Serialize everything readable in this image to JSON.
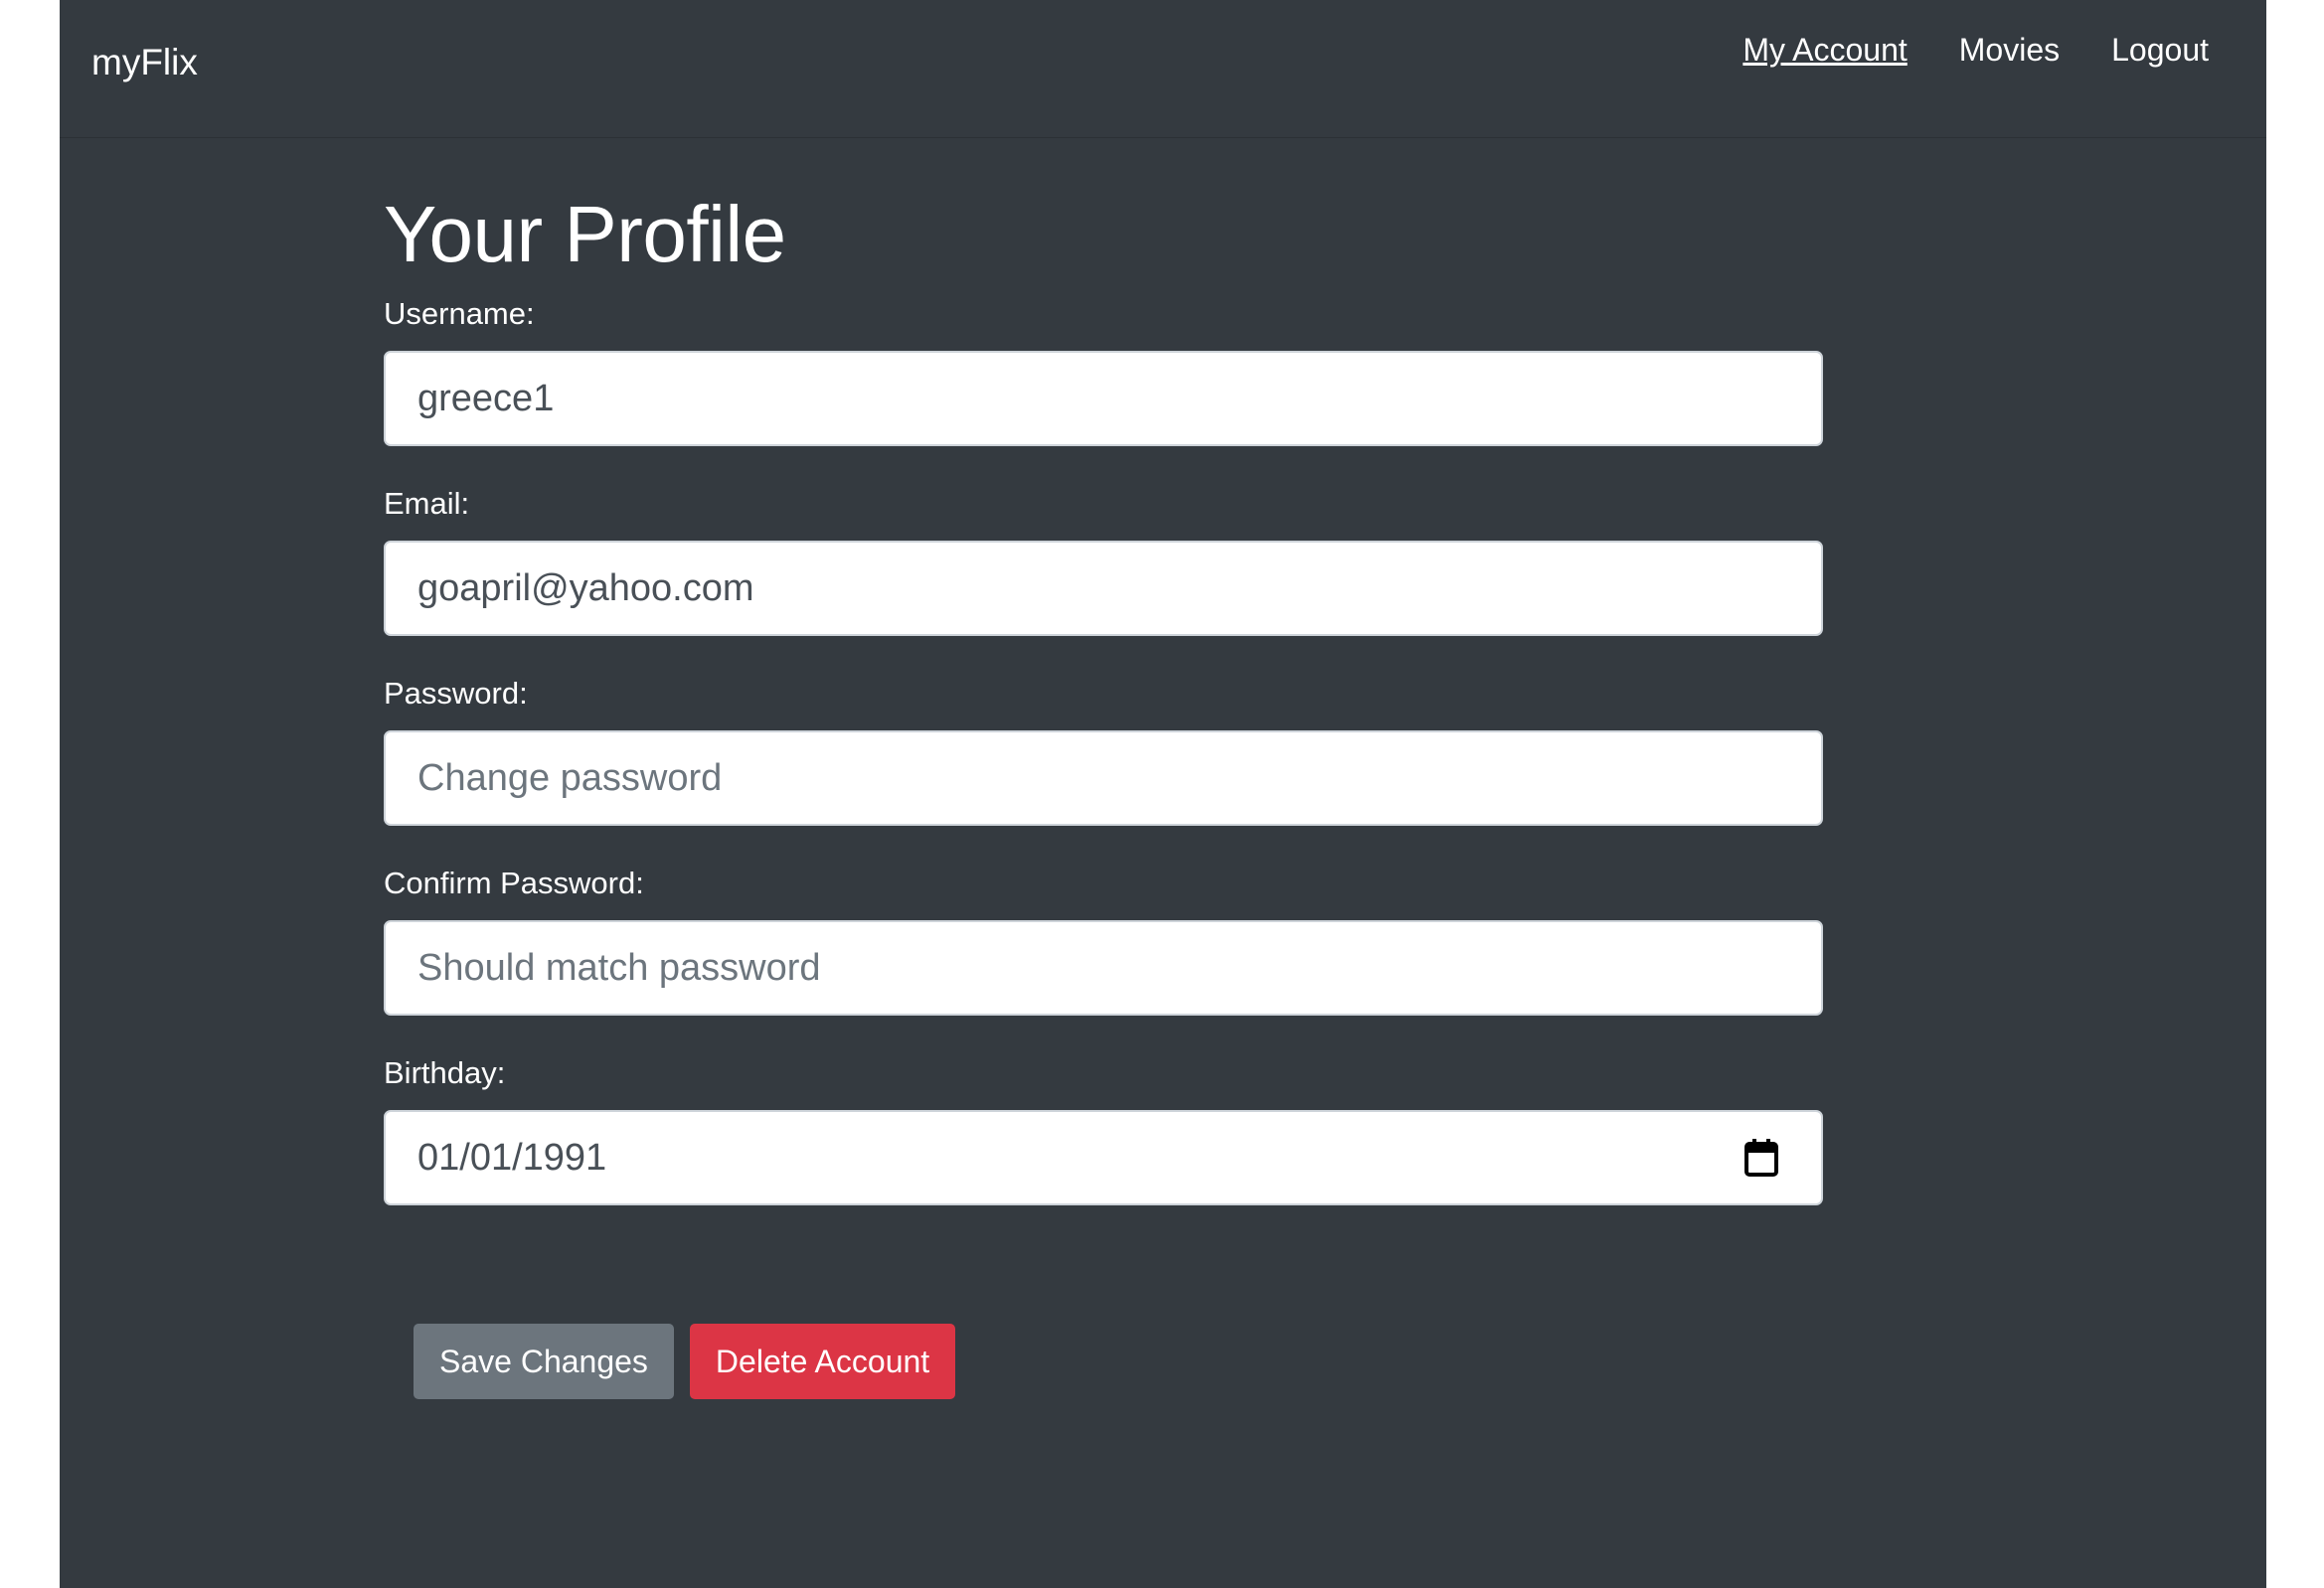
{
  "brand": "myFlix",
  "nav": {
    "items": [
      {
        "label": "My Account",
        "active": true
      },
      {
        "label": "Movies",
        "active": false
      },
      {
        "label": "Logout",
        "active": false
      }
    ]
  },
  "profile": {
    "title": "Your Profile",
    "username": {
      "label": "Username:",
      "value": "greece1"
    },
    "email": {
      "label": "Email:",
      "value": "goapril@yahoo.com"
    },
    "password": {
      "label": "Password:",
      "placeholder": "Change password"
    },
    "confirm_password": {
      "label": "Confirm Password:",
      "placeholder": "Should match password"
    },
    "birthday": {
      "label": "Birthday:",
      "value": "01/01/1991"
    }
  },
  "actions": {
    "save_label": "Save Changes",
    "delete_label": "Delete Account"
  },
  "colors": {
    "background": "#343a40",
    "secondary_button": "#6c757d",
    "danger_button": "#dc3545"
  },
  "icons": {
    "birthday_picker": "calendar-icon"
  }
}
